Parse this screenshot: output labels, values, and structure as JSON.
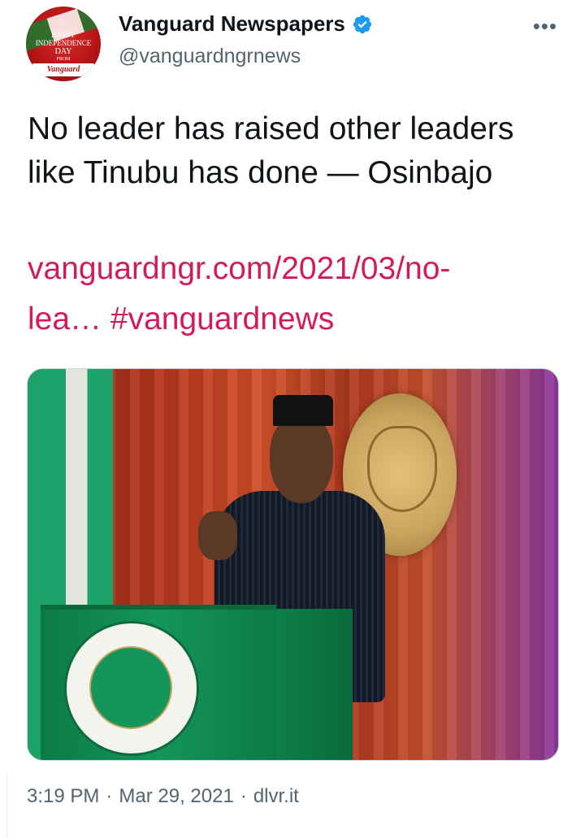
{
  "account": {
    "name": "Vanguard Newspapers",
    "handle": "@vanguardngrnews",
    "avatar_text": [
      "HAPPY",
      "INDEPENDENCE",
      "DAY",
      "FROM"
    ],
    "avatar_brand": "Vanguard",
    "verified_icon": "verified-badge-icon"
  },
  "tweet": {
    "text": "No leader has raised other leaders like Tinubu has done — Osinbajo",
    "link_line1": "vanguardngr.com/2021/03/no-",
    "link_line2": "lea…",
    "hashtag": "#vanguardnews"
  },
  "footer": {
    "time": "3:19 PM",
    "date": "Mar 29, 2021",
    "source": "dlvr.it",
    "separator": "·"
  },
  "colors": {
    "link": "#d31b5a",
    "verified": "#1d9bf0",
    "muted": "#536471"
  }
}
